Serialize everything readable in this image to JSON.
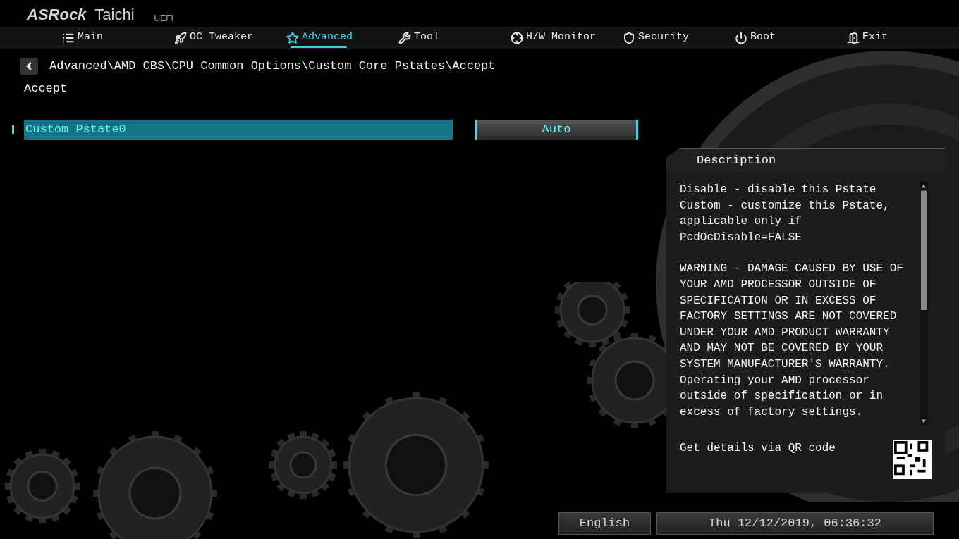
{
  "header": {
    "brand": "ASRock",
    "product": "Taichi",
    "firmware": "UEFI"
  },
  "tabs": [
    {
      "label": "Main",
      "selected": false
    },
    {
      "label": "OC Tweaker",
      "selected": false
    },
    {
      "label": "Advanced",
      "selected": true
    },
    {
      "label": "Tool",
      "selected": false
    },
    {
      "label": "H/W Monitor",
      "selected": false
    },
    {
      "label": "Security",
      "selected": false
    },
    {
      "label": "Boot",
      "selected": false
    },
    {
      "label": "Exit",
      "selected": false
    }
  ],
  "breadcrumb": "Advanced\\AMD CBS\\CPU Common Options\\Custom Core Pstates\\Accept",
  "page_title": "Accept",
  "settings": [
    {
      "label": "Custom Pstate0",
      "value": "Auto",
      "selected": true
    }
  ],
  "description": {
    "title": "Description",
    "sections": [
      [
        "Disable - disable this Pstate",
        "Custom - customize this Pstate, applicable only if PcdOcDisable=FALSE"
      ],
      [
        "WARNING - DAMAGE CAUSED BY USE OF YOUR AMD PROCESSOR OUTSIDE OF SPECIFICATION OR IN EXCESS OF FACTORY SETTINGS ARE NOT COVERED UNDER YOUR AMD PRODUCT WARRANTY AND MAY NOT BE COVERED BY YOUR SYSTEM MANUFACTURER'S WARRANTY.",
        "Operating your AMD processor outside of specification or in excess of factory settings."
      ]
    ],
    "qr_text": "Get details via QR code"
  },
  "status_bar": {
    "language": "English",
    "datetime": "Thu 12/12/2019, 06:36:32"
  }
}
